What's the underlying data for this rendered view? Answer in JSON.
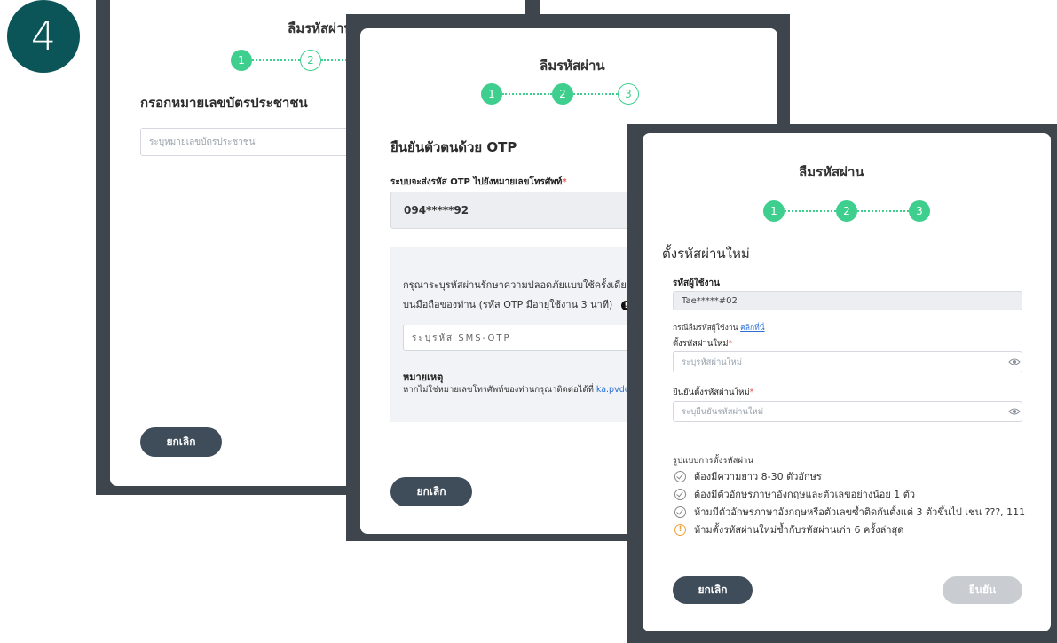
{
  "step_number": "4",
  "screen1": {
    "title": "ลืมรหัสผ่าน",
    "steps": [
      "1",
      "2"
    ],
    "heading": "กรอกหมายเลขบัตรประชาชน",
    "id_placeholder": "ระบุหมายเลขบัตรประชาชน",
    "cancel_label": "ยกเลิก"
  },
  "screen2": {
    "title": "ลืมรหัสผ่าน",
    "steps": [
      "1",
      "2",
      "3"
    ],
    "heading": "ยืนยันตัวตนด้วย OTP",
    "phone_label": "ระบบจะส่งรหัส OTP ไปยังหมายเลขโทรศัพท์",
    "phone_value": "094*****92",
    "otp_info_line1": "กรุณาระบุรหัสผ่านรักษาความปลอดภัยแบบใช้ครั้งเดียว (SM",
    "otp_info_line2": "บนมือถือของท่าน (รหัส OTP มีอายุใช้งาน 3 นาที)",
    "otp_placeholder": "ระบุรหัส SMS-OTP",
    "note_title": "หมายเหตุ",
    "note_text": "หากไม่ใช่หมายเลขโทรศัพท์ของท่านกรุณาติดต่อได้ที่",
    "note_link": "ka.pvdcallcen",
    "cancel_label": "ยกเลิก"
  },
  "screen3": {
    "title": "ลืมรหัสผ่าน",
    "steps": [
      "1",
      "2",
      "3"
    ],
    "heading": "ตั้งรหัสผ่านใหม่",
    "username_label": "รหัสผู้ใช้งาน",
    "username_value": "Tae*****#02",
    "forgot_text": "กรณีลืมรหัสผู้ใช้งาน",
    "forgot_link": "คลิกที่นี่",
    "new_password_label": "ตั้งรหัสผ่านใหม่",
    "new_password_placeholder": "ระบุรหัสผ่านใหม่",
    "confirm_password_label": "ยืนยันตั้งรหัสผ่านใหม่",
    "confirm_password_placeholder": "ระบุยืนยันรหัสผ่านใหม่",
    "rules_title": "รูปแบบการตั้งรหัสผ่าน",
    "rules": [
      "ต้องมีความยาว 8-30 ตัวอักษร",
      "ต้องมีตัวอักษรภาษาอังกฤษและตัวเลขอย่างน้อย 1 ตัว",
      "ห้ามมีตัวอักษรภาษาอังกฤษหรือตัวเลขซ้ำติดกันตั้งแต่ 3 ตัวขึ้นไป เช่น ???, 111",
      "ห้ามตั้งรหัสผ่านใหม่ซ้ำกับรหัสผ่านเก่า 6 ครั้งล่าสุด"
    ],
    "cancel_label": "ยกเลิก",
    "confirm_label": "ยืนยัน"
  },
  "colors": {
    "step_green": "#3ecf8e",
    "badge_teal": "#0b5559",
    "frame_dark": "#3e454c",
    "button_dark": "#3f4c5a"
  }
}
